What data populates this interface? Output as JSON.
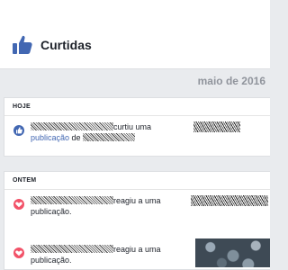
{
  "header": {
    "title": "Curtidas"
  },
  "month": "maio de 2016",
  "sections": [
    {
      "label": "HOJE",
      "items": [
        {
          "pre": "curtiu uma",
          "link": "publicação",
          "mid": " de",
          "post": ""
        }
      ]
    },
    {
      "label": "ONTEM",
      "items": [
        {
          "pre": "reagiu a uma",
          "post": "publicação."
        },
        {
          "pre": "reagiu a uma",
          "post": "publicação."
        }
      ]
    }
  ],
  "colors": {
    "like_badge": "#4267b2",
    "love_badge": "#f25268",
    "thumb_icon": "#4267b2",
    "link": "#4267b2"
  },
  "icons": {
    "header": "thumbs-up-icon",
    "like": "like-badge-icon",
    "love": "heart-badge-icon"
  }
}
